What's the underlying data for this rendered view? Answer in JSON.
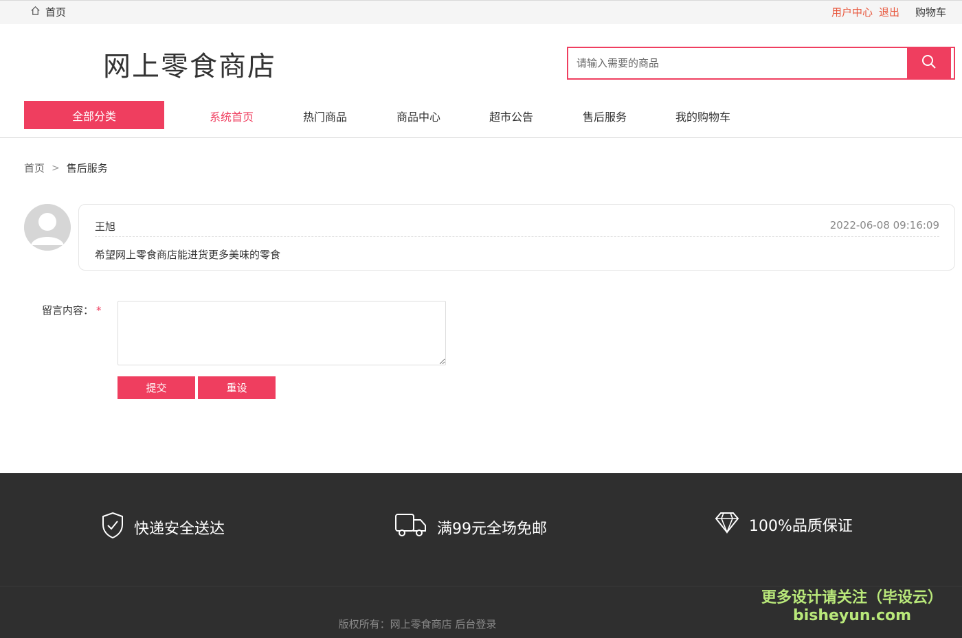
{
  "topbar": {
    "home": "首页",
    "user_center": "用户中心",
    "logout": "退出",
    "cart": "购物车"
  },
  "logo": "网上零食商店",
  "search": {
    "placeholder": "请输入需要的商品"
  },
  "nav": {
    "all_categories": "全部分类",
    "items": [
      "系统首页",
      "热门商品",
      "商品中心",
      "超市公告",
      "售后服务",
      "我的购物车"
    ]
  },
  "breadcrumb": {
    "home": "首页",
    "separator": ">",
    "current": "售后服务"
  },
  "message": {
    "author": "王旭",
    "time": "2022-06-08 09:16:09",
    "content": "希望网上零食商店能进货更多美味的零食"
  },
  "form": {
    "label": "留言内容：",
    "required_mark": "*",
    "submit": "提交",
    "reset": "重设"
  },
  "footer": {
    "features": [
      "快递安全送达",
      "满99元全场免邮",
      "100%品质保证"
    ],
    "copyright": "版权所有：网上零食商店",
    "admin_login": "后台登录",
    "watermark_line1": "更多设计请关注（毕设云）",
    "watermark_line2": "bisheyun.com"
  },
  "colors": {
    "accent": "#ef3e5f",
    "topbar_link": "#e8573d",
    "footer_bg": "#2f2f2f"
  }
}
